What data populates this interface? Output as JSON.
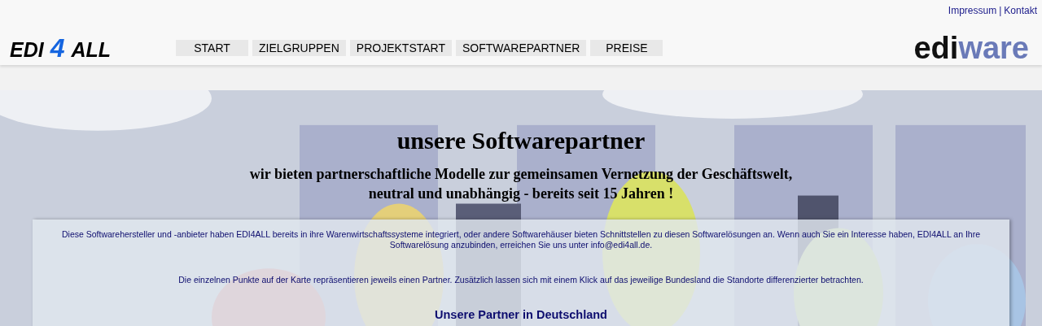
{
  "top_links": [
    "Impressum",
    "Kontakt"
  ],
  "top_links_separator": "|",
  "logo": {
    "parts": [
      "EDI",
      "4",
      "ALL"
    ]
  },
  "brand_logo": {
    "parts": [
      "edi",
      "ware"
    ]
  },
  "nav": [
    "START",
    "ZIELGRUPPEN",
    "PROJEKTSTART",
    "SOFTWAREPARTNER",
    "PREISE"
  ],
  "hero": {
    "kind": "picture",
    "title": "unsere Softwarepartner",
    "subtitle_lines": [
      "wir bieten partnerschaftliche Modelle zur gemeinsamen Vernetzung der Geschäftswelt,",
      "neutral und unabhängig - bereits seit 15 Jahren !"
    ]
  },
  "content": {
    "intro": "Diese Softwarehersteller und -anbieter haben EDI4ALL bereits in ihre Warenwirtschaftssysteme integriert, oder andere Softwarehäuser bieten Schnittstellen zu diesen Softwarelösungen an. Wenn auch Sie ein Interesse haben, EDI4ALL an Ihre Softwarelösung anzubinden, erreichen Sie uns unter info@edi4all.de.",
    "map_hint": "Die einzelnen Punkte auf der Karte repräsentieren jeweils einen Partner. Zusätzlich lassen sich mit einem Klick auf das jeweilige Bundesland die Standorte differenzierter betrachten.",
    "heading": "Unsere Partner in Deutschland"
  }
}
